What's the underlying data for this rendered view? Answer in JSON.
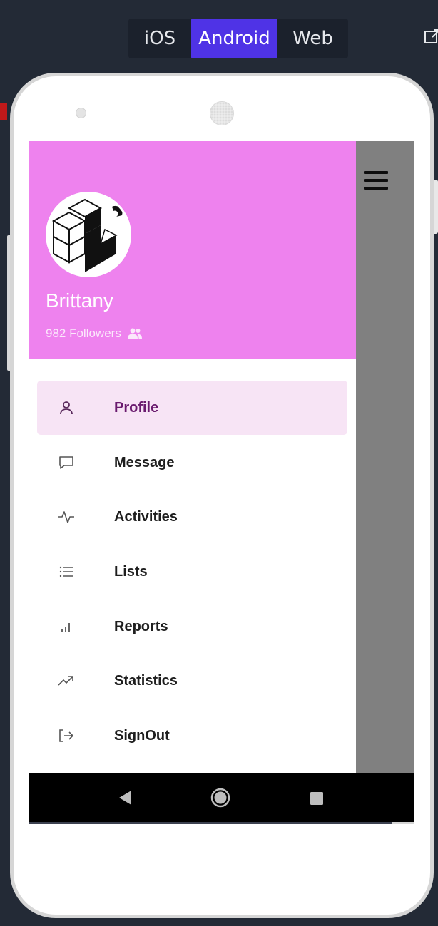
{
  "platform_tabs": [
    {
      "label": "iOS"
    },
    {
      "label": "Android",
      "active": true
    },
    {
      "label": "Web"
    }
  ],
  "colors": {
    "header": "#ee82ee",
    "active_item_bg": "#f7e4f5",
    "active_tab": "#4f33e6",
    "scrim": "#808080"
  },
  "drawer": {
    "user": {
      "name": "Brittany",
      "followers": "982 Followers"
    },
    "menu": [
      {
        "label": "Profile",
        "icon": "person-icon",
        "active": true
      },
      {
        "label": "Message",
        "icon": "message-icon"
      },
      {
        "label": "Activities",
        "icon": "activity-icon"
      },
      {
        "label": "Lists",
        "icon": "list-icon"
      },
      {
        "label": "Reports",
        "icon": "bar-chart-icon"
      },
      {
        "label": "Statistics",
        "icon": "trending-up-icon"
      },
      {
        "label": "SignOut",
        "icon": "sign-out-icon"
      }
    ]
  },
  "icons": {
    "hamburger": "menu-icon",
    "followers": "people-icon",
    "nav_back": "back-triangle-icon",
    "nav_home": "home-circle-icon",
    "nav_recents": "recents-square-icon",
    "open_external": "open-external-icon"
  }
}
